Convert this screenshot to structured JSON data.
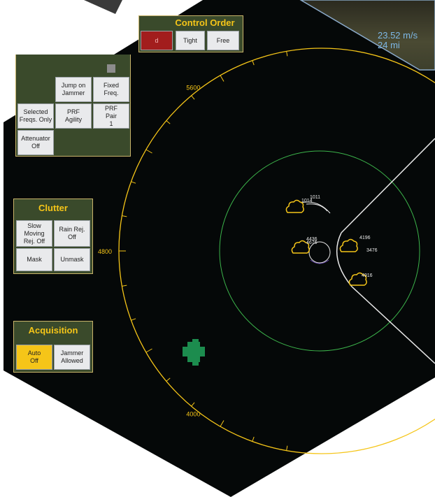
{
  "control_order": {
    "title": "Control Order",
    "buttons": [
      {
        "label": "Tight"
      },
      {
        "label": "Free"
      }
    ]
  },
  "jamming_panel": {
    "buttons": [
      {
        "label": "Jump on\nJammer"
      },
      {
        "label": "Fixed\nFreq."
      },
      {
        "label": "Selected\nFreqs. Only"
      },
      {
        "label": "PRF\nAgility"
      },
      {
        "label": "PRF\nPair\n1"
      },
      {
        "label": "Attenuator\nOff"
      }
    ]
  },
  "clutter": {
    "title": "Clutter",
    "buttons": [
      {
        "label": "Slow\nMoving\nRej. Off"
      },
      {
        "label": "Rain Rej.\nOff"
      },
      {
        "label": "Mask"
      },
      {
        "label": "Unmask"
      }
    ]
  },
  "acquisition": {
    "title": "Acquisition",
    "buttons": [
      {
        "label": "Auto\nOff"
      },
      {
        "label": "Jammer\nAllowed"
      }
    ]
  },
  "video_overlay": {
    "speed": "23.52 m/s",
    "distance": "24 mi"
  },
  "radar": {
    "range_labels": [
      "5600",
      "4800",
      "4000"
    ],
    "tracks": [
      {
        "label": "1011"
      },
      {
        "label": "1014"
      },
      {
        "label": "4436"
      },
      {
        "label": "4676"
      },
      {
        "label": "4196"
      },
      {
        "label": "3476"
      },
      {
        "label": "4916"
      }
    ]
  },
  "colors": {
    "background": "#050808",
    "panel": "#3a4a2b",
    "accent_yellow": "#f5c518",
    "alert_red": "#a21d1d",
    "range_ring_green": "#3cb44b",
    "friendly_green": "#1c8c4e"
  }
}
